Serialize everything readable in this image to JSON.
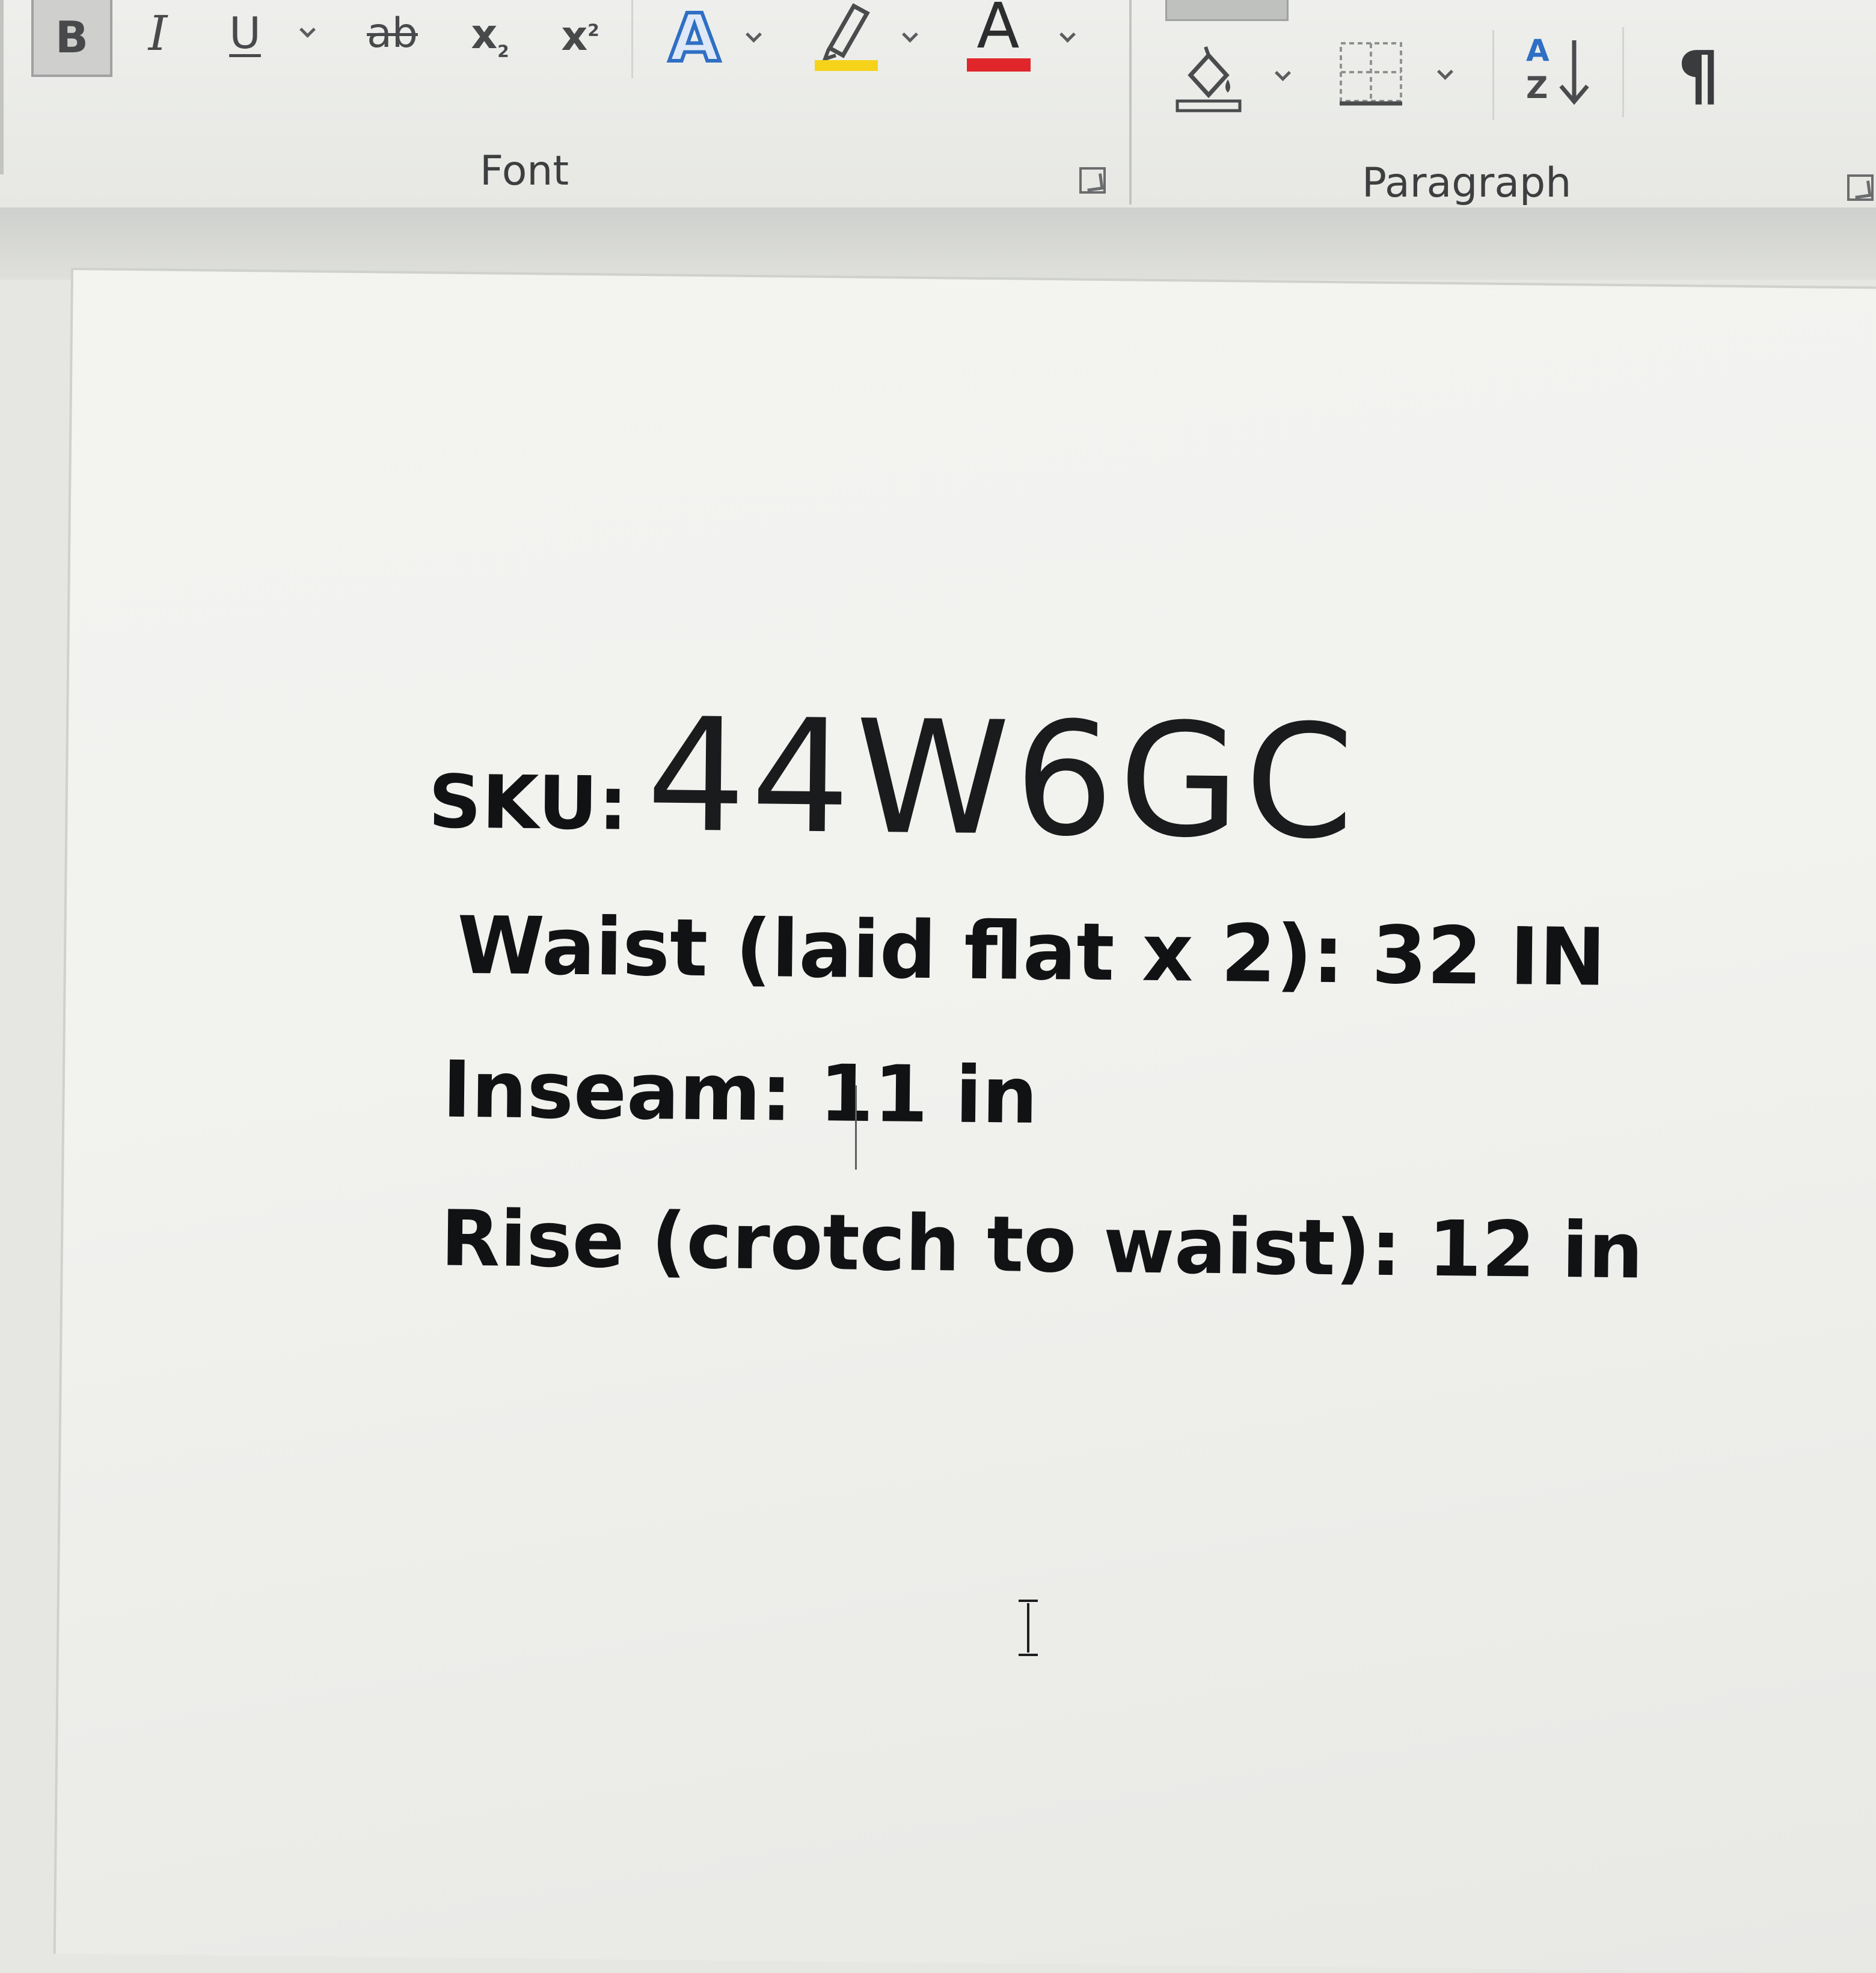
{
  "ribbon": {
    "font_group": {
      "label": "Font",
      "buttons": {
        "bold": "B",
        "italic": "I",
        "underline": "U",
        "strikethrough": "ab",
        "subscript_base": "x",
        "subscript_mark": "2",
        "superscript_base": "x",
        "superscript_mark": "2",
        "text_effects": "A",
        "font_color": "A"
      },
      "highlight_color": "#f5d31a",
      "font_color_bar": "#e0262b"
    },
    "paragraph_group": {
      "label": "Paragraph",
      "buttons": {
        "sort_top": "A",
        "sort_bottom": "Z",
        "show_marks": "¶"
      }
    }
  },
  "document": {
    "sku_label": "SKU:",
    "sku_value": "44W6GC",
    "waist": "Waist (laid flat x 2):  32 IN",
    "inseam": "Inseam: 11 in",
    "rise": "Rise (crotch to waist): 12 in"
  },
  "colors": {
    "text_effects_blue": "#2f6fc4",
    "accent_highlight": "#f5d31a",
    "accent_red": "#e0262b"
  }
}
